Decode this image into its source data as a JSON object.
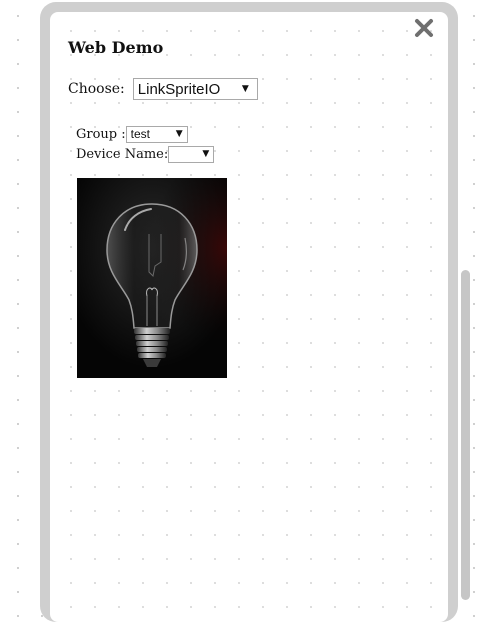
{
  "dialog": {
    "title": "Web Demo",
    "close_icon": "close-x-icon"
  },
  "choose": {
    "label": "Choose:",
    "selected": "LinkSpriteIO"
  },
  "group": {
    "label": "Group :",
    "selected": "test"
  },
  "device": {
    "label": "Device Name:",
    "selected": ""
  },
  "image": {
    "icon": "lightbulb-image"
  },
  "colors": {
    "frame": "#cfcfcf",
    "close": "#6f6f6f",
    "scroll_thumb": "#c6c6c6",
    "image_bg": "#050505"
  }
}
